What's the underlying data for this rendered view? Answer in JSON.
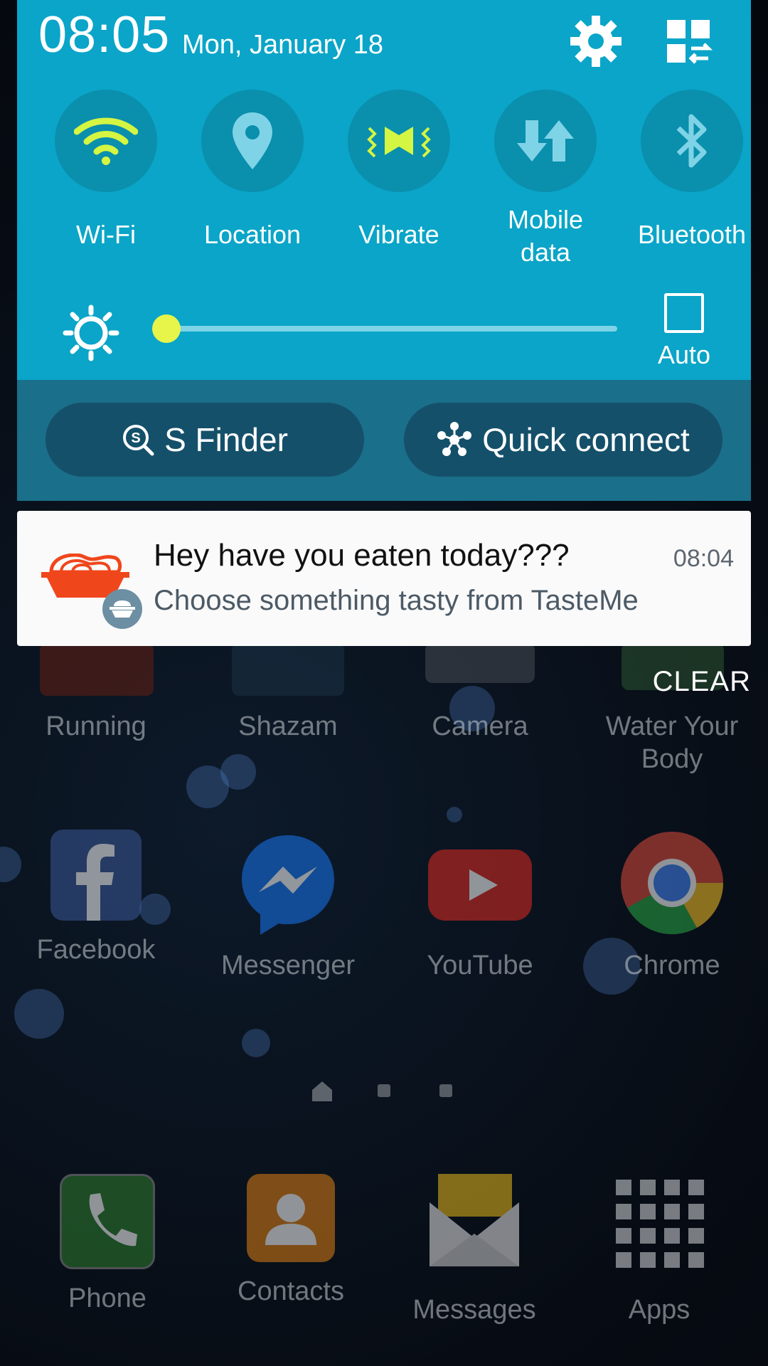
{
  "status": {
    "time": "08:05",
    "date": "Mon, January 18"
  },
  "quick_toggles": [
    {
      "label": "Wi-Fi",
      "icon": "wifi-icon",
      "active": true
    },
    {
      "label": "Location",
      "icon": "location-icon",
      "active": false
    },
    {
      "label": "Vibrate",
      "icon": "vibrate-icon",
      "active": true
    },
    {
      "label": "Mobile data",
      "icon": "mobile-data-icon",
      "active": false
    },
    {
      "label": "Bluetooth",
      "icon": "bluetooth-icon",
      "active": false
    }
  ],
  "brightness": {
    "level": 0.03,
    "auto_label": "Auto",
    "auto_checked": false
  },
  "actions": {
    "s_finder": "S Finder",
    "quick_connect": "Quick connect"
  },
  "notification": {
    "title": "Hey have you eaten today???",
    "text": "Choose something  tasty from TasteMe",
    "time": "08:04",
    "app_icon": "noodle-bowl-icon"
  },
  "clear_label": "CLEAR",
  "home_apps_row1": [
    {
      "label": "Running",
      "color": "#c0391a"
    },
    {
      "label": "Shazam",
      "color": "#3b88c8"
    },
    {
      "label": "Camera",
      "color": "#9aa3ab"
    },
    {
      "label": "Water Your Body",
      "color": "#44a64a"
    }
  ],
  "home_apps_row2": [
    {
      "label": "Facebook",
      "color": "#3b5998"
    },
    {
      "label": "Messenger",
      "color": "#0a84ff"
    },
    {
      "label": "YouTube",
      "color": "#e02a20"
    },
    {
      "label": "Chrome",
      "color": "#dd4b39"
    }
  ],
  "dock": [
    {
      "label": "Phone",
      "color": "#3db33d"
    },
    {
      "label": "Contacts",
      "color": "#f08a1a"
    },
    {
      "label": "Messages",
      "color": "#f3c332"
    },
    {
      "label": "Apps",
      "color": "#c9ced3"
    }
  ],
  "colors": {
    "shade": "#0aa5c8",
    "toggle_active": "#d4f542",
    "toggle_inactive": "#7fd3e6"
  }
}
